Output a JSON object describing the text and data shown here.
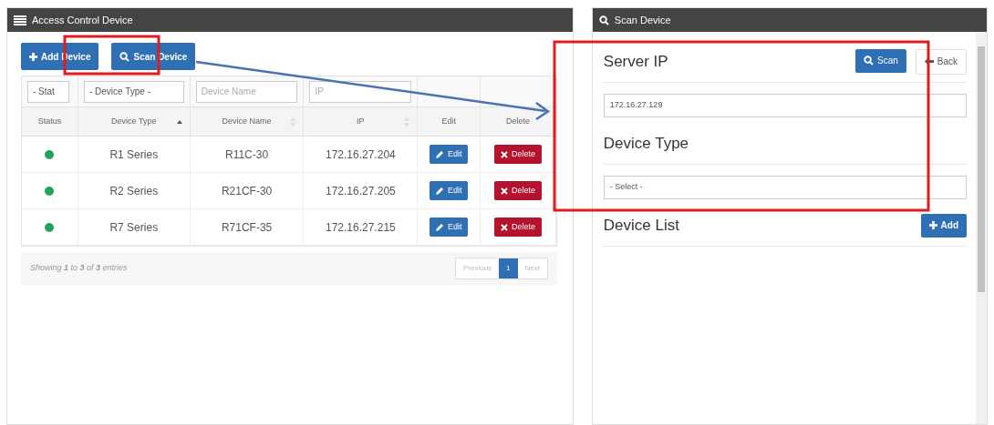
{
  "left_panel": {
    "title": "Access Control Device",
    "toolbar": [
      {
        "kind": "add",
        "label": "Add Device"
      },
      {
        "kind": "scan",
        "label": "Scan Device"
      }
    ],
    "filters": [
      {
        "kind": "select",
        "value": "- Stat"
      },
      {
        "kind": "select",
        "value": "- Device Type -"
      },
      {
        "kind": "text",
        "placeholder": "Device Name"
      },
      {
        "kind": "text",
        "placeholder": "IP"
      }
    ],
    "columns": [
      {
        "label": "Status",
        "sortable": false,
        "sorted": false
      },
      {
        "label": "Device Type",
        "sortable": true,
        "sorted": true
      },
      {
        "label": "Device Name",
        "sortable": true,
        "sorted": false
      },
      {
        "label": "IP",
        "sortable": true,
        "sorted": false
      },
      {
        "label": "Edit",
        "sortable": false,
        "sorted": false
      },
      {
        "label": "Delete",
        "sortable": false,
        "sorted": false
      }
    ],
    "rows": [
      {
        "color": "#22a35a",
        "device_type": "R1 Series",
        "device_name": "R11C-30",
        "ip": "172.16.27.204",
        "edit": "Edit",
        "delete": "Delete"
      },
      {
        "color": "#22a35a",
        "device_type": "R2 Series",
        "device_name": "R21CF-30",
        "ip": "172.16.27.205",
        "edit": "Edit",
        "delete": "Delete"
      },
      {
        "color": "#22a35a",
        "device_type": "R7 Series",
        "device_name": "R71CF-35",
        "ip": "172.16.27.215",
        "edit": "Edit",
        "delete": "Delete"
      }
    ],
    "info": "Showing **1** to **3** of **3** entries",
    "pagination": [
      {
        "label": "Previous",
        "selected": false,
        "disabled": true
      },
      {
        "label": "1",
        "selected": true,
        "disabled": false
      },
      {
        "label": "Next",
        "selected": false,
        "disabled": true
      }
    ]
  },
  "right_panel": {
    "title": "Scan Device",
    "sections": [
      {
        "heading": "Server IP",
        "buttons": [
          {
            "kind": "scan",
            "label": "Scan"
          },
          {
            "kind": "back",
            "label": "Back"
          }
        ],
        "field": {
          "value": "172.16.27.129"
        }
      },
      {
        "heading": "Device Type",
        "field": {
          "option": "- Select -"
        }
      },
      {
        "heading": "Device List",
        "buttons": [
          {
            "kind": "add",
            "label": "Add"
          }
        ]
      }
    ]
  }
}
